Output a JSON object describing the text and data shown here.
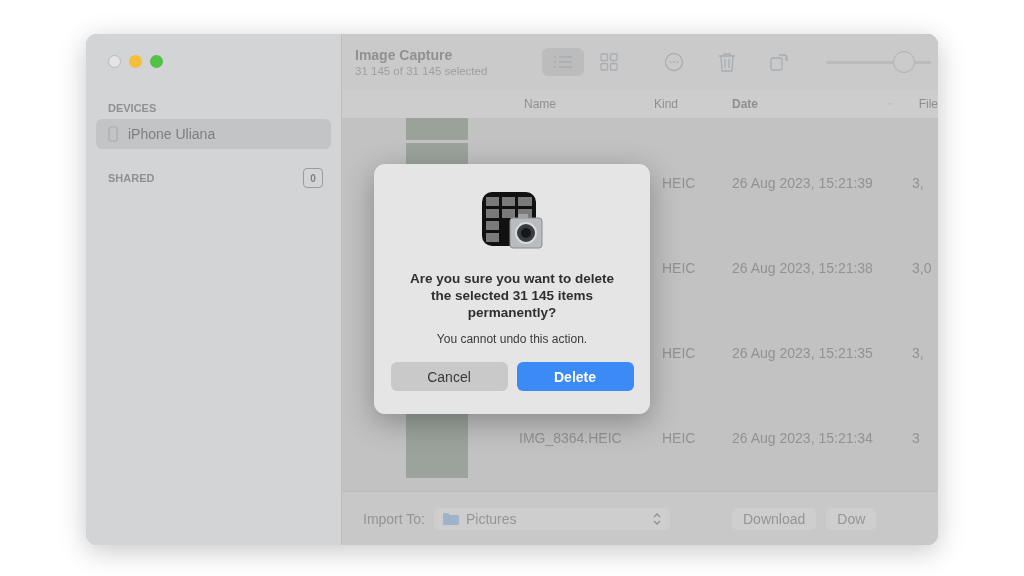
{
  "window": {
    "title": "Image Capture",
    "subtitle": "31 145 of 31 145 selected"
  },
  "sidebar": {
    "sections": [
      {
        "heading": "DEVICES",
        "items": [
          {
            "label": "iPhone Uliana",
            "selected": true
          }
        ]
      },
      {
        "heading": "SHARED",
        "badge": "0"
      }
    ]
  },
  "toolbar": {
    "views": [
      {
        "kind": "list",
        "selected": true
      },
      {
        "kind": "grid",
        "selected": false
      }
    ],
    "zoom": {
      "level": 0.74
    }
  },
  "table": {
    "columns": [
      "Name",
      "Kind",
      "Date",
      "File"
    ],
    "rows": [
      {
        "kind": "HEIC",
        "date": "26 Aug 2023, 15:21:39",
        "size": "3,"
      },
      {
        "kind": "HEIC",
        "date": "26 Aug 2023, 15:21:38",
        "size": "3,0"
      },
      {
        "kind": "HEIC",
        "date": "26 Aug 2023, 15:21:35",
        "size": "3,"
      },
      {
        "name": "IMG_8364.HEIC",
        "kind": "HEIC",
        "date": "26 Aug 2023, 15:21:34",
        "size": "3"
      }
    ]
  },
  "bottom_bar": {
    "import_label": "Import To:",
    "destination": "Pictures",
    "buttons": [
      "Download",
      "Dow"
    ]
  },
  "dialog": {
    "message": "Are you sure you want to delete the selected 31 145 items permanently?",
    "detail": "You cannot undo this action.",
    "buttons": [
      {
        "label": "Cancel",
        "kind": "secondary"
      },
      {
        "label": "Delete",
        "kind": "primary"
      }
    ]
  }
}
